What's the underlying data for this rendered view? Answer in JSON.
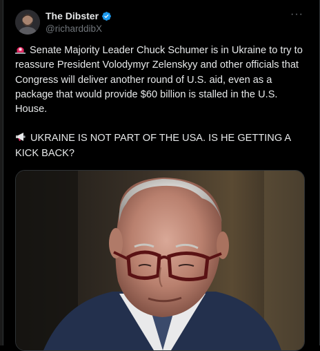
{
  "author": {
    "display_name": "The Dibster",
    "handle": "@richarddibX",
    "verified": true
  },
  "tweet": {
    "paragraph_1": "Senate Majority Leader Chuck Schumer is in Ukraine to try to reassure President Volodymyr Zelenskyy and other officials that Congress will deliver another round of U.S. aid, even as a package that would provide $60 billion is stalled in the U.S. House.",
    "paragraph_2": "UKRAINE IS NOT PART OF THE USA.  IS HE GETTING A KICK BACK?"
  },
  "icons": {
    "avatar": "avatar-photo",
    "verified": "verified-badge-icon",
    "more": "more-options-icon",
    "emoji_1": "rotating-light-emoji",
    "emoji_2": "megaphone-emoji"
  },
  "colors": {
    "background": "#000000",
    "text": "#e7e9ea",
    "secondary": "#71767b",
    "verified": "#1d9bf0",
    "siren": "#e0245e"
  },
  "more_label": "···"
}
